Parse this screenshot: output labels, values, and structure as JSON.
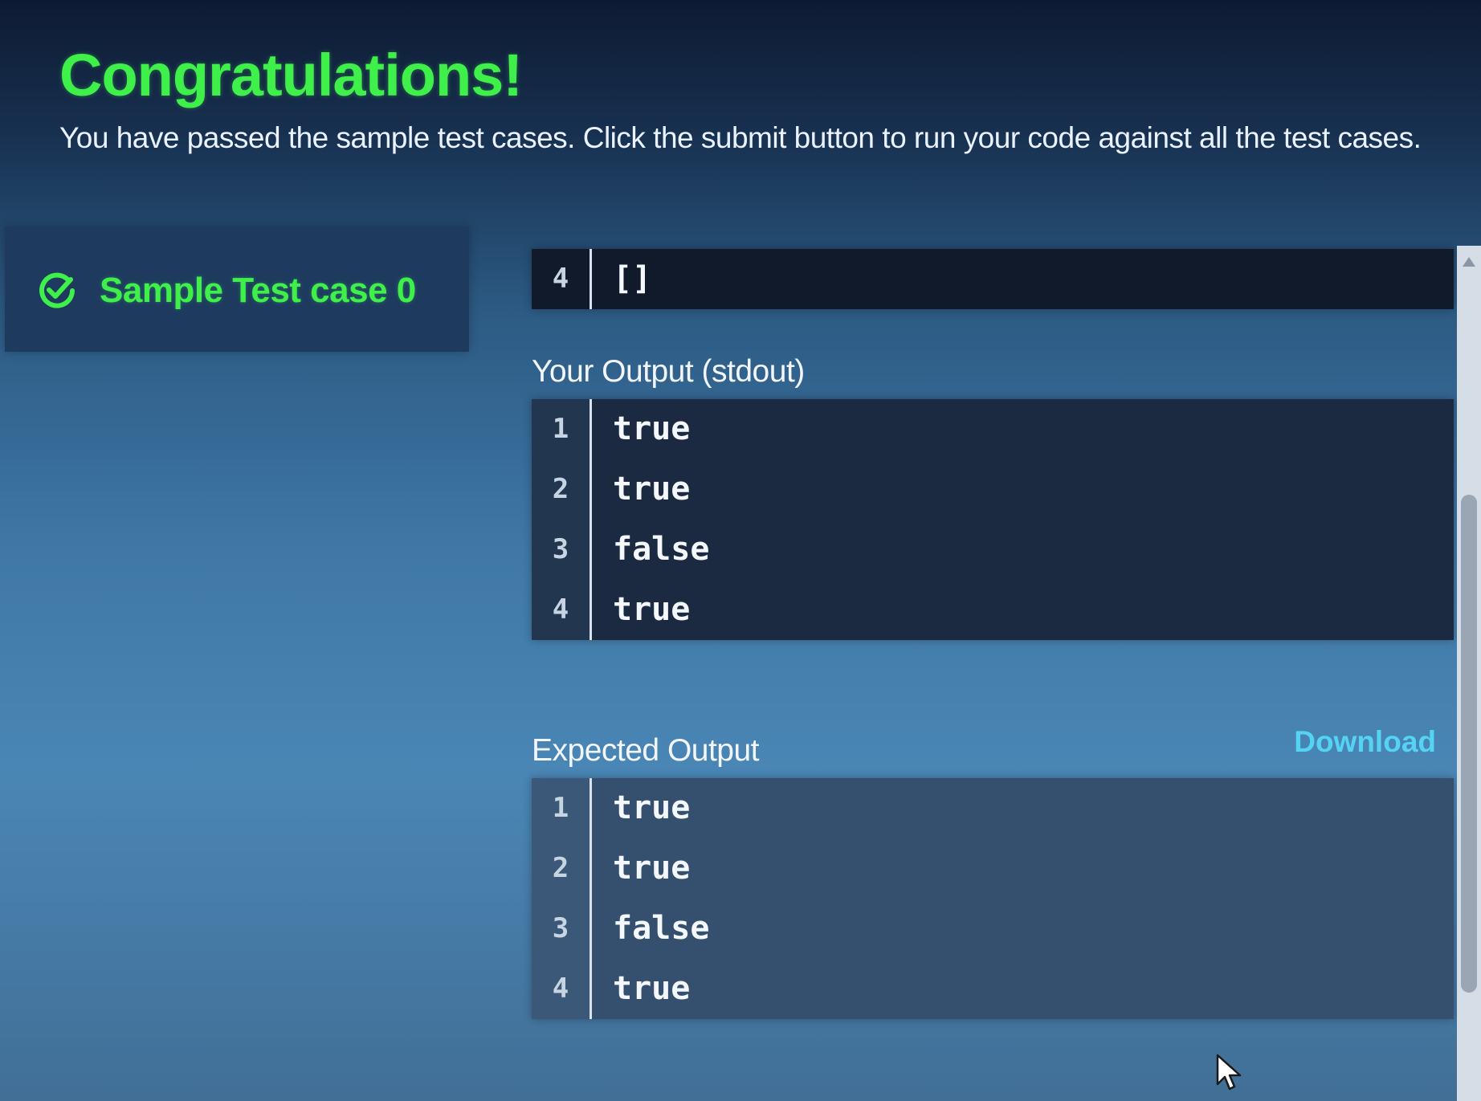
{
  "header": {
    "title": "Congratulations!",
    "subtitle": "You have passed the sample test cases. Click the submit button to run your code against all the test cases."
  },
  "sidebar": {
    "test_cases": [
      {
        "label": "Sample Test case 0",
        "icon": "check-circle-icon",
        "status": "passed"
      }
    ]
  },
  "input": {
    "lines": [
      {
        "n": "4",
        "text": "[]"
      }
    ]
  },
  "your_output": {
    "title": "Your Output (stdout)",
    "lines": [
      {
        "n": "1",
        "text": "true"
      },
      {
        "n": "2",
        "text": "true"
      },
      {
        "n": "3",
        "text": "false"
      },
      {
        "n": "4",
        "text": "true"
      }
    ]
  },
  "expected_output": {
    "title": "Expected Output",
    "download_label": "Download",
    "lines": [
      {
        "n": "1",
        "text": "true"
      },
      {
        "n": "2",
        "text": "true"
      },
      {
        "n": "3",
        "text": "false"
      },
      {
        "n": "4",
        "text": "true"
      }
    ]
  },
  "colors": {
    "success_green": "#3ff04a",
    "link_cyan": "#55d3f2"
  }
}
